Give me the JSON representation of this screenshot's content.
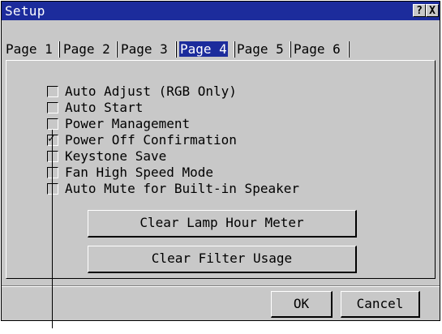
{
  "window": {
    "title": "Setup",
    "help_label": "?",
    "close_label": "X"
  },
  "tabs": [
    {
      "label": "Page 1",
      "active": false
    },
    {
      "label": "Page 2",
      "active": false
    },
    {
      "label": "Page 3",
      "active": false
    },
    {
      "label": "Page 4",
      "active": true
    },
    {
      "label": "Page 5",
      "active": false
    },
    {
      "label": "Page 6",
      "active": false
    }
  ],
  "options": [
    {
      "label": "Auto Adjust (RGB Only)",
      "checked": false
    },
    {
      "label": "Auto Start",
      "checked": false
    },
    {
      "label": "Power Management",
      "checked": false
    },
    {
      "label": "Power Off Confirmation",
      "checked": true
    },
    {
      "label": "Keystone Save",
      "checked": false
    },
    {
      "label": "Fan High Speed Mode",
      "checked": false
    },
    {
      "label": "Auto Mute for Built-in Speaker",
      "checked": false
    }
  ],
  "actions": {
    "clear_lamp": "Clear Lamp Hour Meter",
    "clear_filter": "Clear Filter Usage"
  },
  "footer": {
    "ok": "OK",
    "cancel": "Cancel"
  },
  "colors": {
    "titlebar": "#1c2c9c",
    "dialog_bg": "#c8c8c8"
  }
}
